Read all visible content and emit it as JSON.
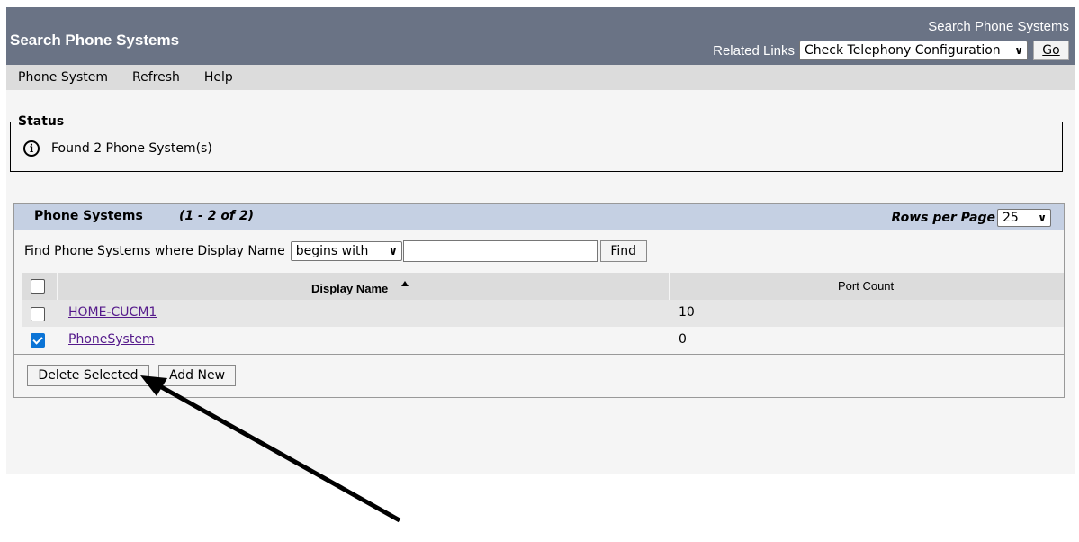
{
  "header": {
    "app_title": "Search Phone Systems",
    "page_title": "Search Phone Systems",
    "related_links_label": "Related Links",
    "related_links_value": "Check Telephony Configuration",
    "go_label": "Go"
  },
  "menu": [
    "Phone System",
    "Refresh",
    "Help"
  ],
  "status": {
    "legend": "Status",
    "message": "Found 2 Phone System(s)",
    "icon": "info-icon"
  },
  "panel": {
    "title": "Phone Systems",
    "count": "(1 - 2 of 2)",
    "rows_per_page_label": "Rows per Page",
    "rows_per_page_value": "25"
  },
  "find": {
    "label": "Find Phone Systems where Display Name",
    "operator": "begins with",
    "value": "",
    "button": "Find"
  },
  "table": {
    "columns": [
      "Display Name",
      "Port Count"
    ],
    "rows": [
      {
        "checked": false,
        "display_name": "HOME-CUCM1",
        "port_count": "10"
      },
      {
        "checked": true,
        "display_name": "PhoneSystem",
        "port_count": "0"
      }
    ]
  },
  "actions": {
    "delete_label": "Delete Selected",
    "add_label": "Add New"
  },
  "colors": {
    "header_bg": "#6a7385",
    "panel_head_bg": "#c5d0e3",
    "link": "#551a8b",
    "checkbox_checked": "#0b74d6"
  }
}
